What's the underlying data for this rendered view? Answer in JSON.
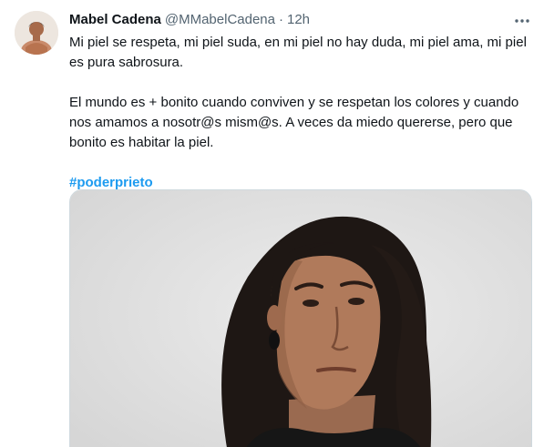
{
  "tweet": {
    "author": {
      "display_name": "Mabel Cadena",
      "handle": "@MMabelCadena"
    },
    "separator": "·",
    "time": "12h",
    "more_icon": "more-horizontal-icon",
    "paragraphs": [
      "Mi piel se respeta, mi piel suda, en mi piel no hay duda, mi piel ama, mi piel es pura sabrosura.",
      "El mundo es + bonito cuando conviven y se respetan los colores y cuando nos amamos a nosotr@s mism@s. A veces da miedo quererse, pero que bonito es habitar la piel."
    ],
    "hashtag": "#poderprieto"
  },
  "colors": {
    "hashtag": "#1d9bf0",
    "secondary_text": "#536471",
    "border": "#cfd9de"
  }
}
